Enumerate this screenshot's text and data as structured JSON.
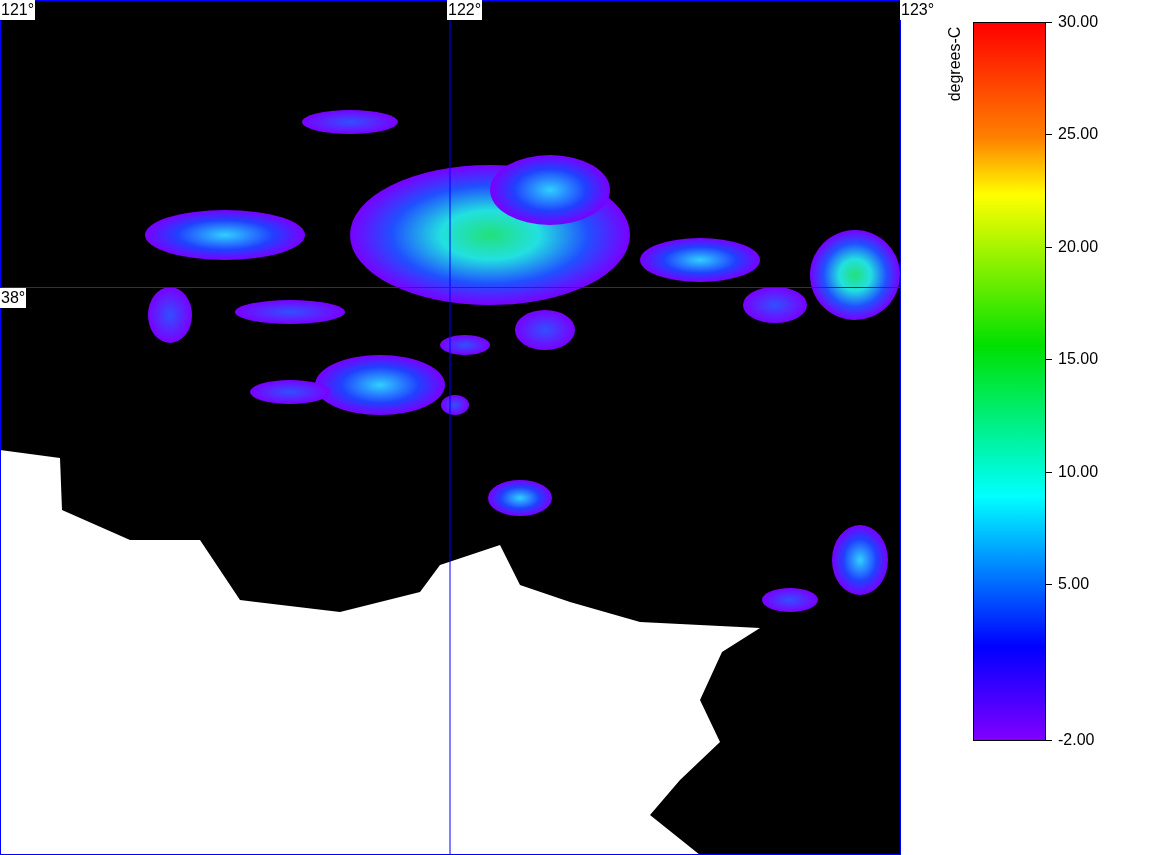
{
  "map": {
    "longitude_labels": [
      "121°",
      "122°",
      "123°"
    ],
    "latitude_labels": [
      "38°"
    ]
  },
  "colorbar": {
    "title": "degrees-C",
    "ticks": [
      "30.00",
      "25.00",
      "20.00",
      "15.00",
      "10.00",
      "5.00",
      "-2.00"
    ]
  }
}
